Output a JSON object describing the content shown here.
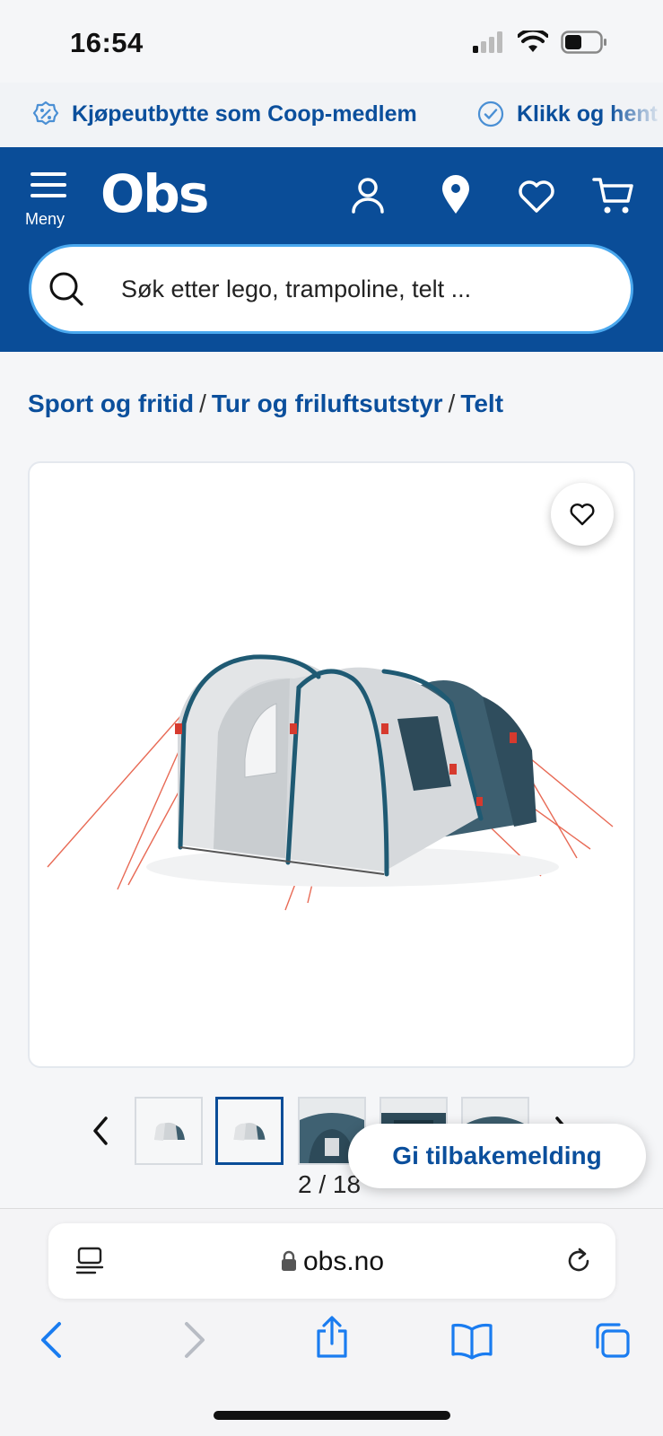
{
  "status": {
    "time": "16:54"
  },
  "promo": {
    "items": [
      {
        "label": "Kjøpeutbytte som Coop-medlem",
        "icon": "percent-badge-icon"
      },
      {
        "label": "Klikk og hent",
        "icon": "check-circle-icon"
      }
    ]
  },
  "header": {
    "menu_label": "Meny",
    "logo_text": "Obs",
    "icons": [
      "user-icon",
      "location-pin-icon",
      "heart-icon",
      "cart-icon"
    ]
  },
  "search": {
    "placeholder": "Søk etter lego, trampoline, telt ..."
  },
  "breadcrumb": [
    "Sport og fritid",
    "Tur og friluftsutstyr",
    "Telt"
  ],
  "gallery": {
    "current": 2,
    "total": 18,
    "pager_text": "2 / 18",
    "thumbnail_count_visible": 5
  },
  "feedback": {
    "label": "Gi tilbakemelding"
  },
  "browser": {
    "url": "obs.no"
  },
  "colors": {
    "brand_blue": "#0a4d98",
    "link_blue": "#0b4f9c",
    "search_border": "#4aa8ee",
    "ios_blue": "#1a7cf0"
  }
}
